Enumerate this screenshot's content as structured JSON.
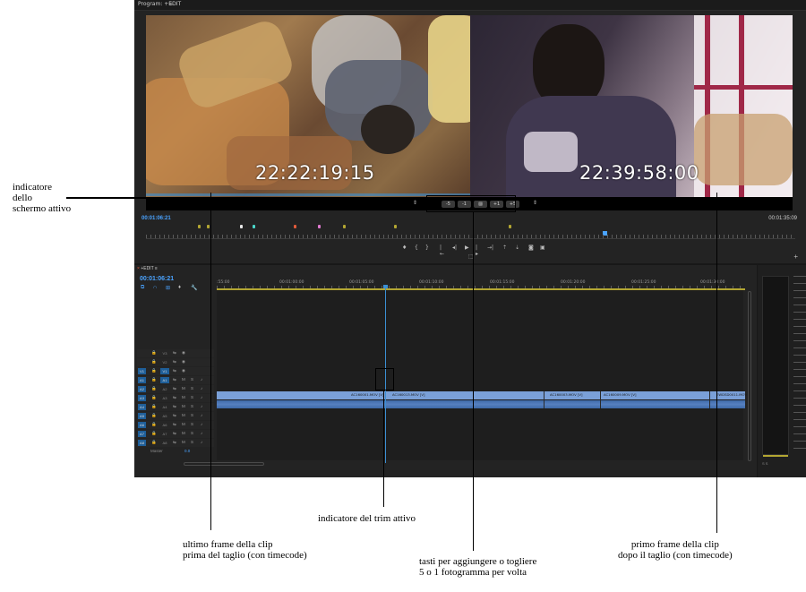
{
  "program_panel": {
    "tab_title": "Program: +EDIT",
    "menu_icon": "≡",
    "timecode_outgoing": "22:22:19:15",
    "timecode_incoming": "22:39:58:00",
    "trim_buttons": [
      "-5",
      "-1",
      "",
      "+1",
      "+5"
    ],
    "current_tc": "00:01:06:21",
    "duration_tc": "00:01:35:09"
  },
  "sequence_panel": {
    "tab_title": "+EDIT",
    "menu_icon": "≡",
    "timecode": "00:01:06:21",
    "ruler_labels": [
      ":55:00",
      "00:01:00:00",
      "00:01:05:00",
      "00:01:10:00",
      "00:01:15:00",
      "00:01:20:00",
      "00:01:25:00",
      "00:01:30:00"
    ],
    "clips": [
      "AC160001.MOV [V]",
      "AC160013.MOV [V]",
      "AC160003.MOV [V]",
      "AC160009.MOV [V]",
      "EWDSD0011.MOV"
    ],
    "tracks": [
      {
        "l": "",
        "n": "V3"
      },
      {
        "l": "",
        "n": "V2"
      },
      {
        "l": "V1",
        "n": "V1"
      },
      {
        "l": "A1",
        "n": "A1"
      },
      {
        "l": "A2",
        "n": "A2"
      },
      {
        "l": "A3",
        "n": "A3"
      },
      {
        "l": "A4",
        "n": "A4"
      },
      {
        "l": "A5",
        "n": "A5"
      },
      {
        "l": "A6",
        "n": "A6"
      },
      {
        "l": "A7",
        "n": "A7"
      },
      {
        "l": "A8",
        "n": "A8"
      }
    ],
    "master_label": "Master",
    "master_value": "0.0"
  },
  "meters": {
    "scale": [
      "0",
      "-3",
      "-6",
      "-9",
      "-12",
      "-15",
      "-18",
      "-21",
      "-24",
      "-27",
      "-30",
      "-33",
      "-36",
      "-39",
      "-42",
      "-45",
      "-48",
      "-51",
      "-54",
      "-57",
      "dB"
    ],
    "foot": "S    S"
  },
  "annotations": {
    "active_screen": "indicatore\ndello\nschermo attivo",
    "trim_active": "indicatore del trim attivo",
    "last_frame": "ultimo frame della clip\nprima del taglio (con timecode)",
    "trim_buttons": "tasti per aggiungere o togliere\n5 o 1 fotogramma per volta",
    "first_frame": "primo frame della clip\ndopo il taglio (con timecode)"
  },
  "colors": {
    "accent": "#3b8fd4",
    "timecode_blue": "#4aa3ff",
    "clip_video": "#7aa0d8",
    "clip_audio": "#3e6aa8",
    "work_area": "#b3a632"
  }
}
